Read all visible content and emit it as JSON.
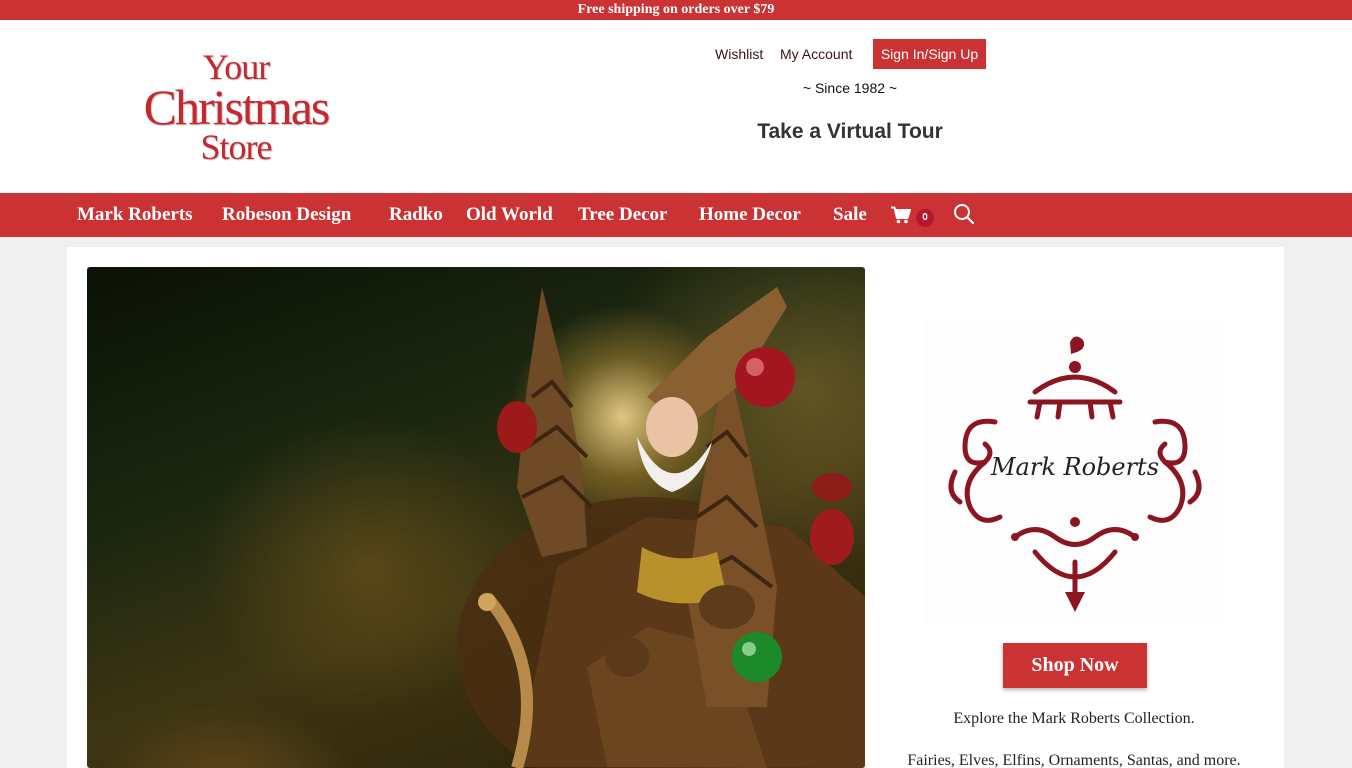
{
  "topbar": {
    "text": "Free shipping on orders over $79"
  },
  "logo": {
    "line1": "Your",
    "line2": "Christmas",
    "line3": "Store"
  },
  "account": {
    "wishlist": "Wishlist",
    "my_account": "My Account",
    "sign_in": "Sign In/Sign Up"
  },
  "tagline": "~ Since 1982 ~",
  "virtual_tour": "Take a Virtual Tour",
  "nav": {
    "items": [
      "Mark Roberts",
      "Robeson Design",
      "Radko",
      "Old World",
      "Tree Decor",
      "Home Decor",
      "Sale"
    ],
    "cart_count": "0",
    "cart_icon": "shopping-cart-icon",
    "search_icon": "search-icon"
  },
  "promo": {
    "brand_script": "Mark Roberts",
    "button": "Shop Now",
    "explore": "Explore the Mark Roberts Collection.",
    "description": "Fairies, Elves, Elfins, Ornaments, Santas, and more."
  },
  "colors": {
    "brand_red": "#cb3234",
    "logo_red": "#c8272e",
    "ornament_red": "#8b1520"
  }
}
